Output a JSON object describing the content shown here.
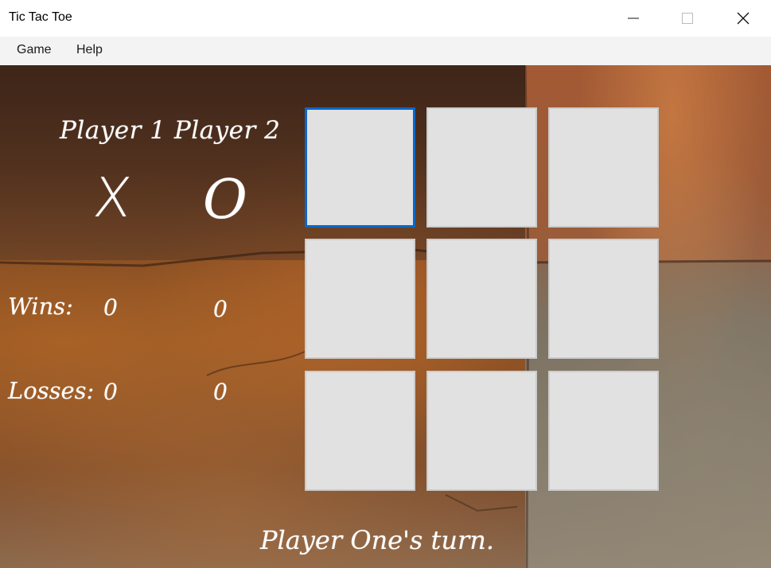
{
  "window": {
    "title": "Tic Tac Toe",
    "controls": [
      "minimize-icon",
      "maximize-icon",
      "close-icon"
    ]
  },
  "menu": {
    "items": [
      {
        "label": "Game"
      },
      {
        "label": "Help"
      }
    ]
  },
  "scoreboard": {
    "header": "Player 1  Player 2",
    "player1_symbol": "X",
    "player2_symbol": "O",
    "wins_label": "Wins:",
    "losses_label": "Losses:",
    "player1_wins": "0",
    "player2_wins": "0",
    "player1_losses": "0",
    "player2_losses": "0"
  },
  "board": {
    "cells": [
      "",
      "",
      "",
      "",
      "",
      "",
      "",
      "",
      ""
    ],
    "focused_cell": 0
  },
  "status": {
    "text": "Player One's turn."
  },
  "colors": {
    "cell_bg": "#e1e1e1",
    "focus_border": "#0a68c9",
    "chalk": "#ffffff"
  }
}
